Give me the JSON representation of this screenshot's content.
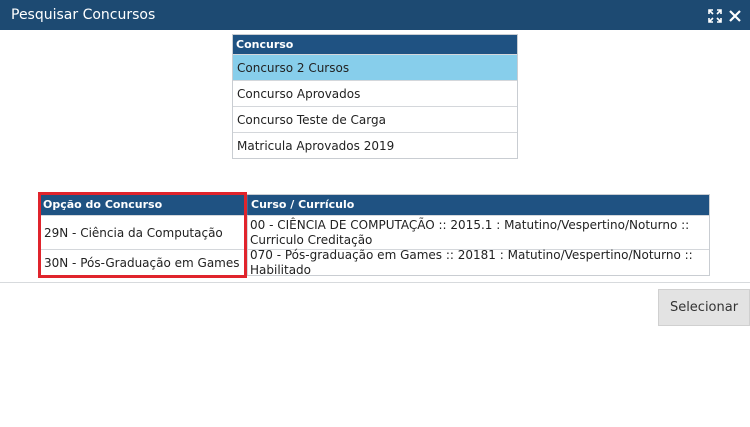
{
  "window": {
    "title": "Pesquisar Concursos",
    "icons": [
      "expand-icon",
      "close-icon"
    ]
  },
  "concurso_table": {
    "header": "Concurso",
    "rows": [
      "Concurso 2 Cursos",
      "Concurso Aprovados",
      "Concurso Teste de Carga",
      "Matricula Aprovados 2019"
    ],
    "selected_index": 0
  },
  "opcoes_table": {
    "headers": [
      "Opção do Concurso",
      "Curso / Currículo"
    ],
    "rows": [
      {
        "opcao": "29N - Ciência da Computação",
        "curso": "00 - CIÊNCIA DE COMPUTAÇÃO :: 2015.1 : Matutino/Vespertino/Noturno :: Curriculo Creditação"
      },
      {
        "opcao": "30N - Pós-Graduação em Games",
        "curso": "070 - Pós-graduação em Games :: 20181 : Matutino/Vespertino/Noturno :: Habilitado"
      }
    ]
  },
  "actions": {
    "select_label": "Selecionar"
  },
  "colors": {
    "titlebar": "#1d4a72",
    "table_header": "#1f5282",
    "selected_row": "#87ceeb",
    "highlight": "#e0242c"
  }
}
